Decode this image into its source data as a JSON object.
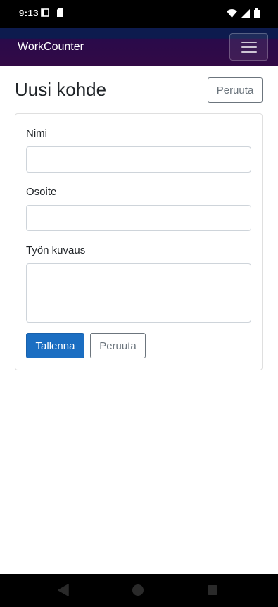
{
  "status_bar": {
    "time": "9:13"
  },
  "navbar": {
    "brand": "WorkCounter",
    "menu_icon": "hamburger-icon"
  },
  "page": {
    "title": "Uusi kohde",
    "header_cancel": "Peruuta"
  },
  "form": {
    "name_label": "Nimi",
    "name_value": "",
    "address_label": "Osoite",
    "address_value": "",
    "description_label": "Työn kuvaus",
    "description_value": "",
    "save_button": "Tallenna",
    "cancel_button": "Peruuta"
  },
  "system_nav": {
    "back_icon": "back-triangle-icon",
    "home_icon": "home-circle-icon",
    "recents_icon": "recents-square-icon"
  },
  "colors": {
    "primary": "#1b6ec2",
    "navbar": "#2a0a4a",
    "outline": "#6c757d"
  }
}
